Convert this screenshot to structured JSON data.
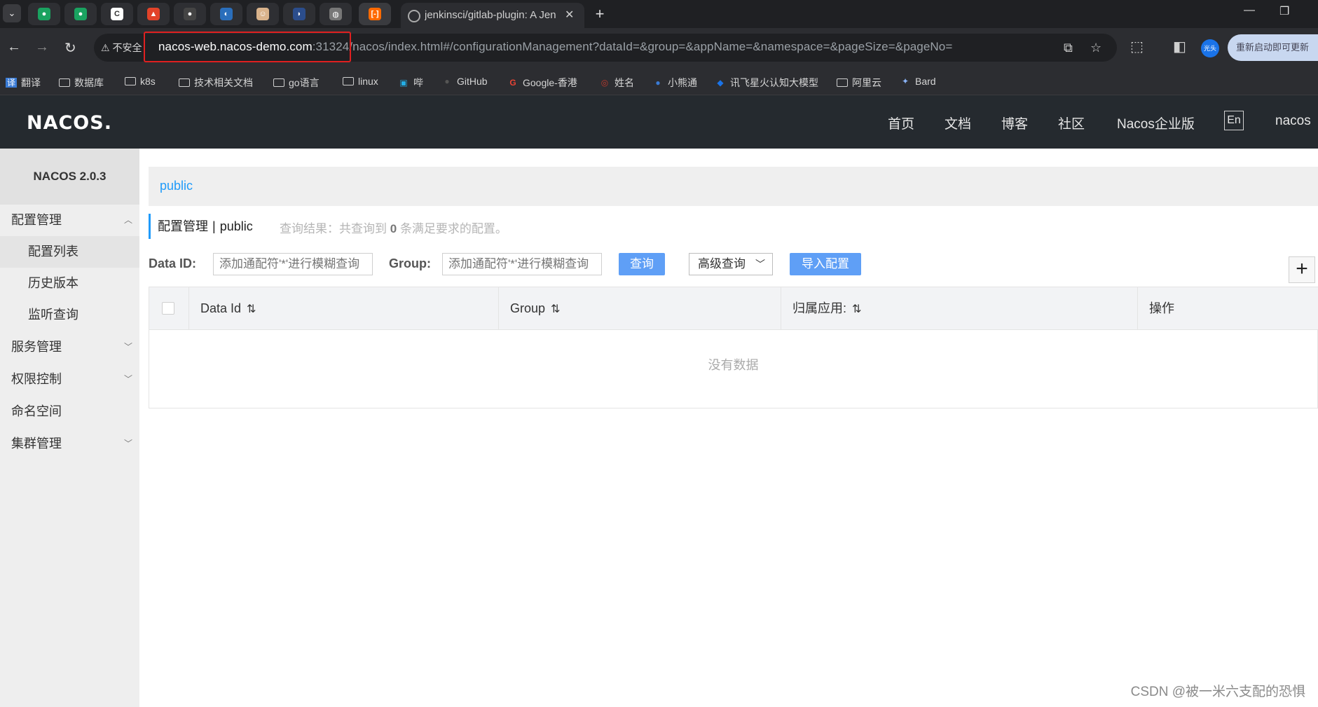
{
  "browser": {
    "tab_title": "jenkinsci/gitlab-plugin: A Jen",
    "security_label": "不安全",
    "url_host": "nacos-web.nacos-demo.com",
    "url_rest": ":31324/nacos/index.html#/configurationManagement?dataId=&group=&appName=&namespace=&pageSize=&pageNo=",
    "profile_text": "光头",
    "update_label": "重新启动即可更新",
    "bookmarks": [
      "翻译",
      "数据库",
      "k8s",
      "技术相关文档",
      "go语言",
      "linux",
      "哔",
      "GitHub",
      "Google-香港",
      "姓名",
      "小熊通",
      "讯飞星火认知大模型",
      "阿里云",
      "Bard"
    ]
  },
  "header": {
    "logo": "NACOS.",
    "nav": [
      "首页",
      "文档",
      "博客",
      "社区",
      "Nacos企业版"
    ],
    "lang": "En",
    "user": "nacos"
  },
  "sidebar": {
    "title": "NACOS 2.0.3",
    "config_mgmt": "配置管理",
    "config_list": "配置列表",
    "history": "历史版本",
    "listen_query": "监听查询",
    "service_mgmt": "服务管理",
    "auth_control": "权限控制",
    "namespace": "命名空间",
    "cluster_mgmt": "集群管理"
  },
  "main": {
    "namespace_tab": "public",
    "breadcrumb_title": "配置管理",
    "breadcrumb_sep": "|",
    "breadcrumb_ns": "public",
    "query_result_prefix": "查询结果：共查询到",
    "query_result_count": "0",
    "query_result_suffix": "条满足要求的配置。",
    "dataid_label": "Data ID:",
    "dataid_placeholder": "添加通配符'*'进行模糊查询",
    "group_label": "Group:",
    "group_placeholder": "添加通配符'*'进行模糊查询",
    "query_button": "查询",
    "advanced_query": "高级查询",
    "import_button": "导入配置",
    "add_button": "+",
    "columns": [
      "Data Id",
      "Group",
      "归属应用:",
      "操作"
    ],
    "empty_text": "没有数据"
  },
  "watermark": "CSDN @被一米六支配的恐惧",
  "colors": {
    "accent": "#209bfa",
    "button_primary": "#5f9ff6",
    "header_bg": "#252a2f",
    "url_highlight": "#e02020"
  }
}
